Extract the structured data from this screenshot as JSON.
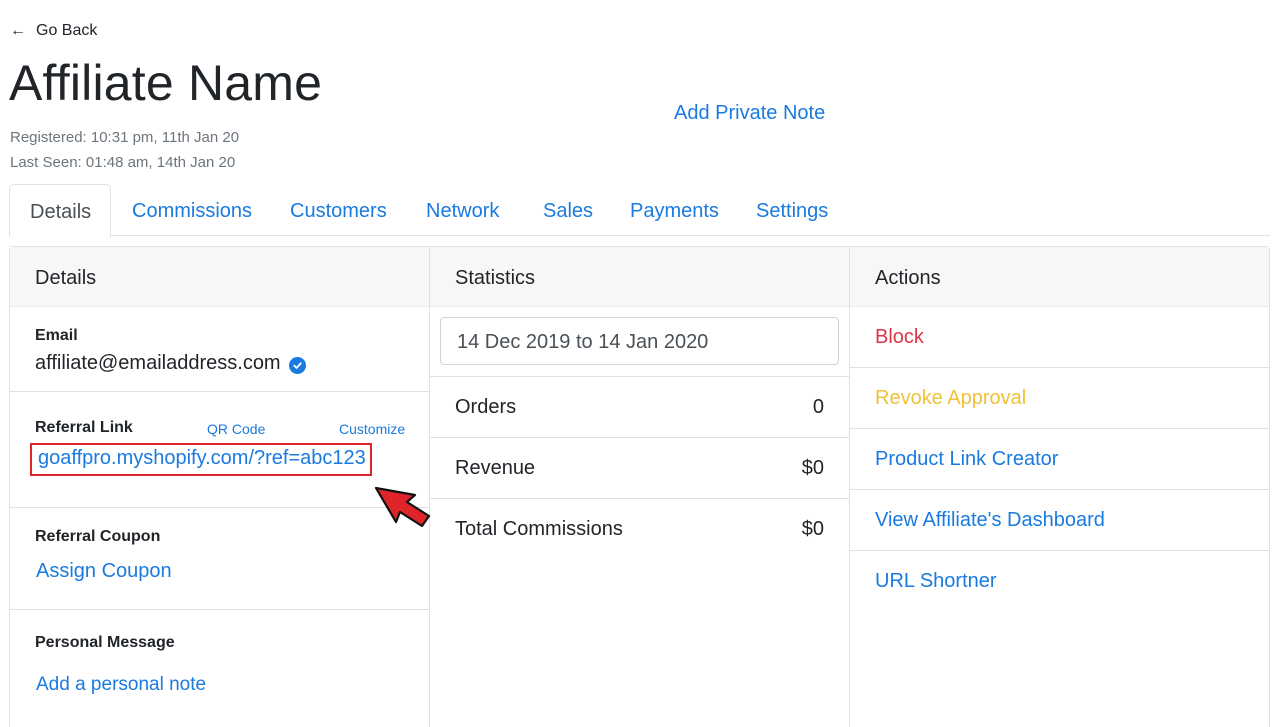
{
  "nav": {
    "back_label": "Go Back"
  },
  "affiliate": {
    "name": "Affiliate Name",
    "registered": "Registered: 10:31 pm, 11th Jan 20",
    "last_seen": "Last Seen: 01:48 am, 14th Jan 20",
    "private_note_label": "Add Private Note"
  },
  "tabs": [
    {
      "label": "Details",
      "active": true
    },
    {
      "label": "Commissions"
    },
    {
      "label": "Customers"
    },
    {
      "label": "Network"
    },
    {
      "label": "Sales"
    },
    {
      "label": "Payments"
    },
    {
      "label": "Settings"
    }
  ],
  "details": {
    "header": "Details",
    "email_label": "Email",
    "email_value": "affiliate@emailaddress.com",
    "referral_label": "Referral Link",
    "qr_label": "QR Code",
    "customize_label": "Customize",
    "referral_link": "goaffpro.myshopify.com/?ref=abc123",
    "coupon_label": "Referral Coupon",
    "assign_coupon": "Assign Coupon",
    "message_label": "Personal Message",
    "add_note": "Add a personal note"
  },
  "statistics": {
    "header": "Statistics",
    "date_range": "14 Dec 2019 to 14 Jan 2020",
    "rows": [
      {
        "label": "Orders",
        "value": "0"
      },
      {
        "label": "Revenue",
        "value": "$0"
      },
      {
        "label": "Total Commissions",
        "value": "$0"
      }
    ]
  },
  "actions": {
    "header": "Actions",
    "items": [
      {
        "label": "Block",
        "color": "#dc3545"
      },
      {
        "label": "Revoke Approval",
        "color": "#f0c038"
      },
      {
        "label": "Product Link Creator",
        "color": "#1a7ae0"
      },
      {
        "label": "View Affiliate's Dashboard",
        "color": "#1a7ae0"
      },
      {
        "label": "URL Shortner",
        "color": "#1a7ae0"
      }
    ]
  },
  "colors": {
    "link": "#1a7ae0",
    "highlight": "#e0252a",
    "verified": "#1a7ae0"
  }
}
